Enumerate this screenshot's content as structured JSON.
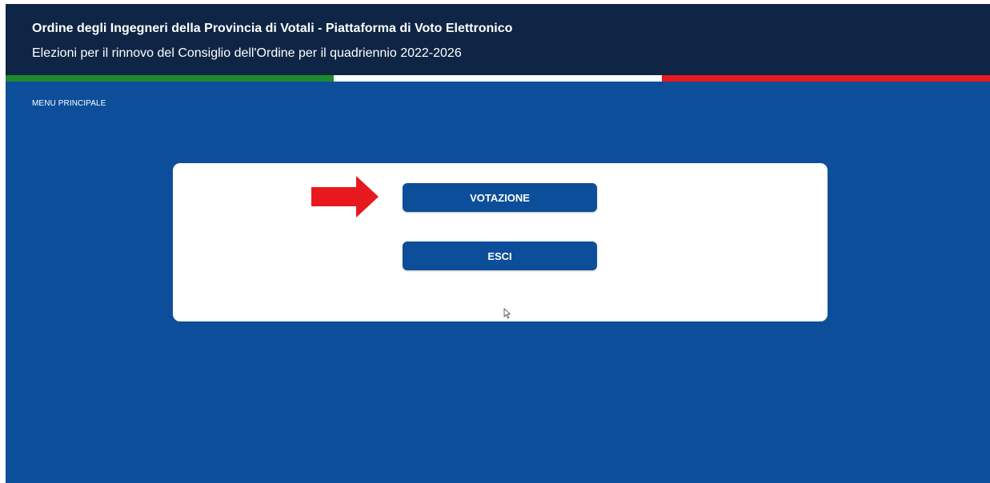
{
  "header": {
    "title": "Ordine degli Ingegneri della Provincia di Votali - Piattaforma di Voto Elettronico",
    "subtitle": "Elezioni per il rinnovo del Consiglio dell'Ordine per il quadriennio 2022-2026"
  },
  "flag": {
    "colors": [
      "#1e8a2e",
      "#ffffff",
      "#e8191e"
    ]
  },
  "menu": {
    "label": "MENU PRINCIPALE"
  },
  "card": {
    "vote_button_label": "VOTAZIONE",
    "exit_button_label": "ESCI"
  },
  "annotation": {
    "arrow_color": "#e8191e",
    "arrow_icon": "right-arrow-icon"
  },
  "colors": {
    "background": "#0d4e9a",
    "header": "#0f2545",
    "button": "#0d4e9a",
    "card": "#ffffff"
  }
}
